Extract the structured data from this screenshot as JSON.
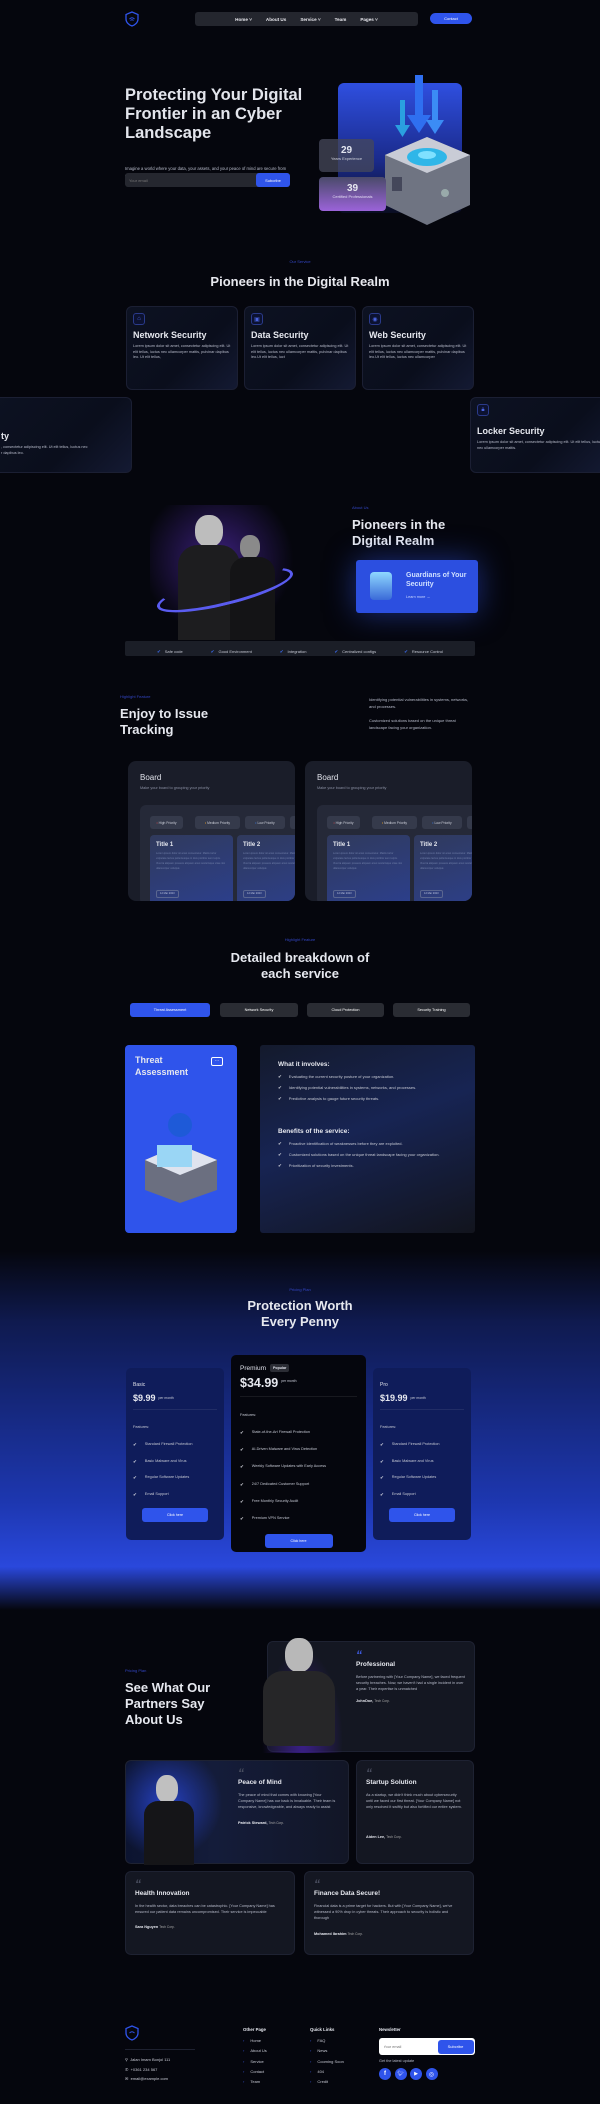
{
  "nav": {
    "items": [
      "Home",
      "About Us",
      "Service",
      "Team",
      "Pages"
    ],
    "dropdowns": [
      true,
      false,
      true,
      false,
      true
    ],
    "contact": "Contact"
  },
  "hero": {
    "title": "Protecting Your Digital Frontier in an Cyber Landscape",
    "subtitle": "Imagine a world where your data, your assets, and your peace of mind are secure from every evolving threat.",
    "email_placeholder": "Your email",
    "subscribe": "Subcribe",
    "stats": [
      {
        "value": "29",
        "label": "Years Experience"
      },
      {
        "value": "39",
        "label": "Certified Professionals"
      }
    ]
  },
  "services": {
    "label": "Our Service",
    "title": "Pioneers in the Digital Realm",
    "cards": [
      {
        "icon": "network-icon",
        "title": "Network Security",
        "text": "Lorem ipsum dolor sit amet, consectetur adipiscing elit. Ut elit tellus, luctus nec ullamcorper mattis, pulvinar dapibus leo. Ut elit tellus,"
      },
      {
        "icon": "safe-icon",
        "title": "Data Security",
        "text": "Lorem ipsum dolor sit amet, consectetur adipiscing elit. Ut elit tellus, luctus nec ullamcorper mattis, pulvinar dapibus leo.Ut elit tellus, luct"
      },
      {
        "icon": "globe-icon",
        "title": "Web Security",
        "text": "Lorem ipsum dolor sit amet, consectetur adipiscing elit. Ut elit tellus, luctus nec ullamcorper mattis, pulvinar dapibus leo.Ut elit tellus, luctus nec ullamcorper"
      },
      {
        "icon": "",
        "title": "ty",
        "text": ", consectetur adipiscing elit. Ut elit tellus, luctus nec",
        "text2": "r dapibus leo."
      },
      {
        "icon": "lock-icon",
        "title": "Locker Security",
        "text": "Lorem ipsum dolor sit amet, consectetur adipiscing elit. Ut elit tellus, luctus nec ullamcorper mattis."
      }
    ]
  },
  "about": {
    "label": "About Us",
    "title": "Pioneers in the Digital Realm",
    "card_title": "Guardians of Your Security",
    "card_link": "Learn more →",
    "features": [
      "Safe code",
      "Good Environment",
      "Integration",
      "Centralized configs",
      "Resource Control"
    ]
  },
  "tracking": {
    "label": "Highlight Feature",
    "title": "Enjoy to Issue Tracking",
    "text1": "Identifying potential vulnerabilities in systems, networks, and processes.",
    "text2": "Customized solutions based on the unique threat landscape facing your organization.",
    "board": {
      "title": "Board",
      "subtitle": "Make your board to grouping your priority",
      "chips": [
        "High Priority",
        "Medium Priority",
        "Low Priority"
      ],
      "chip_colors": [
        "#e5484d",
        "#f5a524",
        "#3b82f6"
      ],
      "tasks": [
        {
          "title": "Title 1",
          "text": "Lorem ipsum dolor sit amet consectetur. Mattis tortor vulputate lectus pellentesque in duis porttitor sem turpis. Viverra aliquam posuere aliquam amet scelerisque vitae nisi ullamcorper volutpat.",
          "date": "12 Mar 2023"
        },
        {
          "title": "Title 2",
          "text": "Lorem ipsum dolor sit amet consectetur. Mattis tortor vulputate lectus pellentesque in duis porttitor sem turpis. Viverra aliquam posuere aliquam amet scelerisque vitae nisi ullamcorper volutpat.",
          "date": "12 Mar 2023"
        }
      ]
    }
  },
  "breakdown": {
    "label": "Highlight Feature",
    "title": "Detailed breakdown of each service",
    "tabs": [
      "Threat Assessment",
      "Network Security",
      "Cloud Protection",
      "Security Training"
    ],
    "active_tab": 0,
    "card_title": "Threat Assessment",
    "involves_title": "What it involves:",
    "involves": [
      "Evaluating the current security posture of your organization.",
      "Identifying potential vulnerabilities in systems, networks, and processes.",
      "Predictive analysis to gauge future security threats."
    ],
    "benefits_title": "Benefits of the service:",
    "benefits": [
      "Proactive identification of weaknesses before they are exploited.",
      "Customized solutions based on the unique threat landscape facing your organization.",
      "Prioritization of security investments."
    ]
  },
  "pricing": {
    "label": "Pricing Plan",
    "title": "Protection Worth Every Penny",
    "per": "per month",
    "features_label": "Features:",
    "cta": "Click here",
    "plans": [
      {
        "name": "Basic",
        "price": "$9.99",
        "features": [
          "Standard Firewall Protection",
          "Basic Malware and Virus",
          "Regular Software Updates",
          "Email Support"
        ]
      },
      {
        "name": "Premium",
        "badge": "Popular",
        "price": "$34.99",
        "features": [
          "State-of-the-Art Firewall Protection",
          "AI-Driven Malware and Virus Detection",
          "Weekly Software Updates with Early Access",
          "24/7 Dedicated Customer Support",
          "Free Monthly Security Audit",
          "Premium VPN Service"
        ]
      },
      {
        "name": "Pro",
        "price": "$19.99",
        "features": [
          "Standard Firewall Protection",
          "Basic Malware and Virus",
          "Regular Software Updates",
          "Email Support"
        ]
      }
    ]
  },
  "testimonials": {
    "label": "Pricing Plan",
    "title": "See What Our Partners Say About Us",
    "items": [
      {
        "title": "Professional",
        "text": "Before partnering with [Your Company Name], we faced frequent security breaches. Now, we haven't had a single incident in over a year. Their expertise is unmatched",
        "name": "JohnDoe,",
        "company": "Tech Corp."
      },
      {
        "title": "Peace of Mind",
        "text": "The peace of mind that comes with knowing [Your Company Name] has our back is invaluable. Their team is responsive, knowledgeable, and always ready to assist",
        "name": "Patrick Steward,",
        "company": "Tech Corp."
      },
      {
        "title": "Startup Solution",
        "text": "As a startup, we didn't think much about cybersecurity until we faced our first threat. [Your Company Name] not only resolved it swiftly but also fortified our entire system.",
        "name": "Aiden Lee,",
        "company": "Tech Corp."
      },
      {
        "title": "Health Innovation",
        "text": "In the health sector, data breaches can be catastrophic. [Your Company Name] has ensured our patient data remains uncompromised. Their service is impeccable",
        "name": "Sara Nguyen",
        "company": "Tech Corp."
      },
      {
        "title": "Finance Data Secure!",
        "text": "Financial data is a prime target for hackers. But with [Your Company Name], we've witnessed a 90% drop in cyber threats. Their approach to security is holistic and thorough",
        "name": "Mohamed Ibrahim",
        "company": "Tech Corp."
      }
    ]
  },
  "footer": {
    "address": "Jalan Imam Bonjol 111",
    "phone": "+0361 234 567",
    "email": "email@example.com",
    "other_title": "Other Page",
    "other": [
      "Home",
      "About Us",
      "Service",
      "Contact",
      "Team"
    ],
    "quick_title": "Quick Links",
    "quick": [
      "FAQ",
      "News",
      "Cooming Soon",
      "404",
      "Credit"
    ],
    "news_title": "Newsletter",
    "news_placeholder": "Your email",
    "news_button": "Subcribe",
    "news_note": "Get the latest update",
    "socials": [
      "facebook-icon",
      "twitter-icon",
      "youtube-icon",
      "dribbble-icon"
    ]
  },
  "colors": {
    "accent": "#2f54eb",
    "bg": "#05060d"
  }
}
